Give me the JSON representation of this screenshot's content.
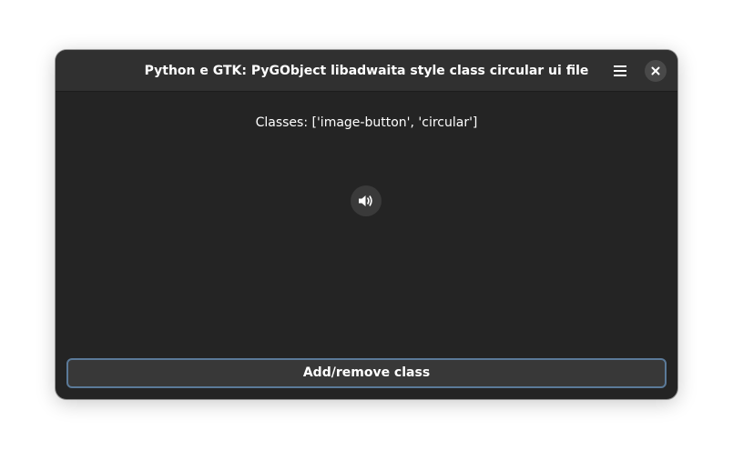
{
  "window": {
    "title": "Python e GTK: PyGObject libadwaita style class circular ui file"
  },
  "header": {
    "menu_icon": "open-menu-icon",
    "close_icon": "window-close-icon"
  },
  "main": {
    "classes_text": "Classes: ['image-button', 'circular']",
    "circular_button_icon": "audio-volume-high-icon",
    "toggle_button_label": "Add/remove class"
  },
  "colors": {
    "window_bg": "#242424",
    "headerbar_bg": "#303030",
    "button_bg": "#383838",
    "focus_ring": "#5b7a99",
    "text": "#ffffff"
  }
}
